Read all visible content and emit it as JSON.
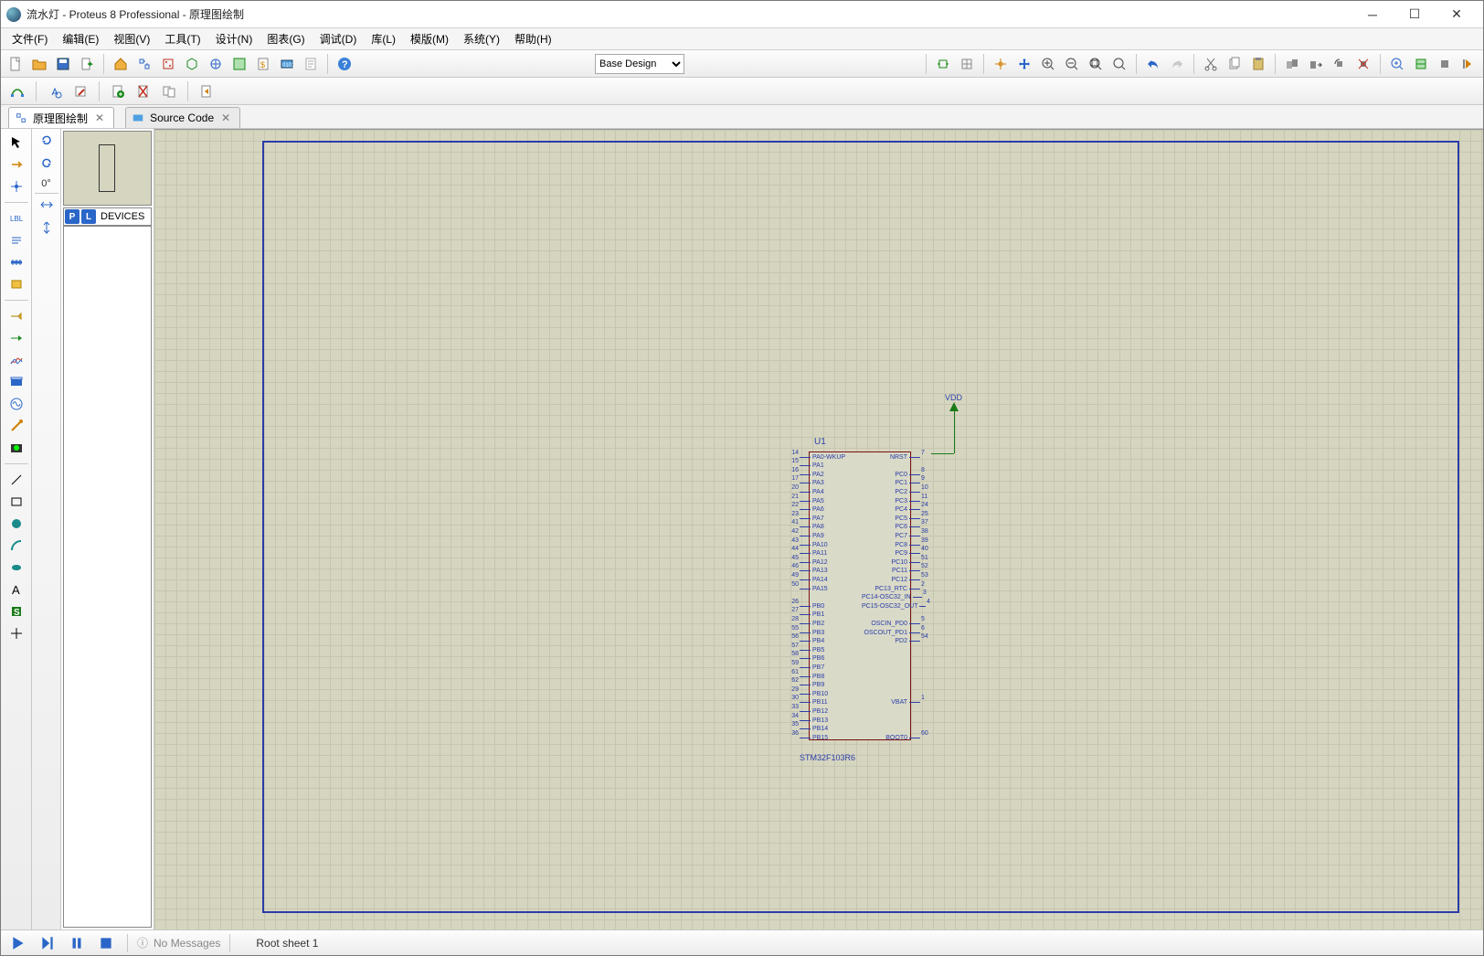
{
  "title": "流水灯 - Proteus 8 Professional - 原理图绘制",
  "menu": {
    "file": "文件(F)",
    "edit": "编辑(E)",
    "view": "视图(V)",
    "tool": "工具(T)",
    "design": "设计(N)",
    "chart": "图表(G)",
    "debug": "调试(D)",
    "lib": "库(L)",
    "template": "模版(M)",
    "system": "系统(Y)",
    "help": "帮助(H)"
  },
  "design_combo": "Base Design",
  "tabs": {
    "schematic": "原理图绘制",
    "source": "Source Code"
  },
  "devices_header": "DEVICES",
  "orient_deg": "0°",
  "component": {
    "ref": "U1",
    "part": "STM32F103R6",
    "left_pins": [
      {
        "n": "14",
        "name": "PA0-WKUP"
      },
      {
        "n": "15",
        "name": "PA1"
      },
      {
        "n": "16",
        "name": "PA2"
      },
      {
        "n": "17",
        "name": "PA3"
      },
      {
        "n": "20",
        "name": "PA4"
      },
      {
        "n": "21",
        "name": "PA5"
      },
      {
        "n": "22",
        "name": "PA6"
      },
      {
        "n": "23",
        "name": "PA7"
      },
      {
        "n": "41",
        "name": "PA8"
      },
      {
        "n": "42",
        "name": "PA9"
      },
      {
        "n": "43",
        "name": "PA10"
      },
      {
        "n": "44",
        "name": "PA11"
      },
      {
        "n": "45",
        "name": "PA12"
      },
      {
        "n": "46",
        "name": "PA13"
      },
      {
        "n": "49",
        "name": "PA14"
      },
      {
        "n": "50",
        "name": "PA15"
      },
      {
        "n": "",
        "name": ""
      },
      {
        "n": "26",
        "name": "PB0"
      },
      {
        "n": "27",
        "name": "PB1"
      },
      {
        "n": "28",
        "name": "PB2"
      },
      {
        "n": "55",
        "name": "PB3"
      },
      {
        "n": "56",
        "name": "PB4"
      },
      {
        "n": "57",
        "name": "PB5"
      },
      {
        "n": "58",
        "name": "PB6"
      },
      {
        "n": "59",
        "name": "PB7"
      },
      {
        "n": "61",
        "name": "PB8"
      },
      {
        "n": "62",
        "name": "PB9"
      },
      {
        "n": "29",
        "name": "PB10"
      },
      {
        "n": "30",
        "name": "PB11"
      },
      {
        "n": "33",
        "name": "PB12"
      },
      {
        "n": "34",
        "name": "PB13"
      },
      {
        "n": "35",
        "name": "PB14"
      },
      {
        "n": "36",
        "name": "PB15"
      }
    ],
    "right_pins": [
      {
        "n": "7",
        "name": "NRST"
      },
      {
        "n": "",
        "name": ""
      },
      {
        "n": "8",
        "name": "PC0"
      },
      {
        "n": "9",
        "name": "PC1"
      },
      {
        "n": "10",
        "name": "PC2"
      },
      {
        "n": "11",
        "name": "PC3"
      },
      {
        "n": "24",
        "name": "PC4"
      },
      {
        "n": "25",
        "name": "PC5"
      },
      {
        "n": "37",
        "name": "PC6"
      },
      {
        "n": "38",
        "name": "PC7"
      },
      {
        "n": "39",
        "name": "PC8"
      },
      {
        "n": "40",
        "name": "PC9"
      },
      {
        "n": "51",
        "name": "PC10"
      },
      {
        "n": "52",
        "name": "PC11"
      },
      {
        "n": "53",
        "name": "PC12"
      },
      {
        "n": "2",
        "name": "PC13_RTC"
      },
      {
        "n": "3",
        "name": "PC14-OSC32_IN"
      },
      {
        "n": "4",
        "name": "PC15-OSC32_OUT"
      },
      {
        "n": "",
        "name": ""
      },
      {
        "n": "5",
        "name": "OSCIN_PD0"
      },
      {
        "n": "6",
        "name": "OSCOUT_PD1"
      },
      {
        "n": "54",
        "name": "PD2"
      },
      {
        "n": "",
        "name": ""
      },
      {
        "n": "",
        "name": ""
      },
      {
        "n": "",
        "name": ""
      },
      {
        "n": "",
        "name": ""
      },
      {
        "n": "",
        "name": ""
      },
      {
        "n": "",
        "name": ""
      },
      {
        "n": "1",
        "name": "VBAT"
      },
      {
        "n": "",
        "name": ""
      },
      {
        "n": "",
        "name": ""
      },
      {
        "n": "",
        "name": ""
      },
      {
        "n": "60",
        "name": "BOOT0"
      }
    ]
  },
  "vdd_label": "VDD",
  "status": {
    "messages": "No Messages",
    "sheet": "Root sheet 1"
  }
}
